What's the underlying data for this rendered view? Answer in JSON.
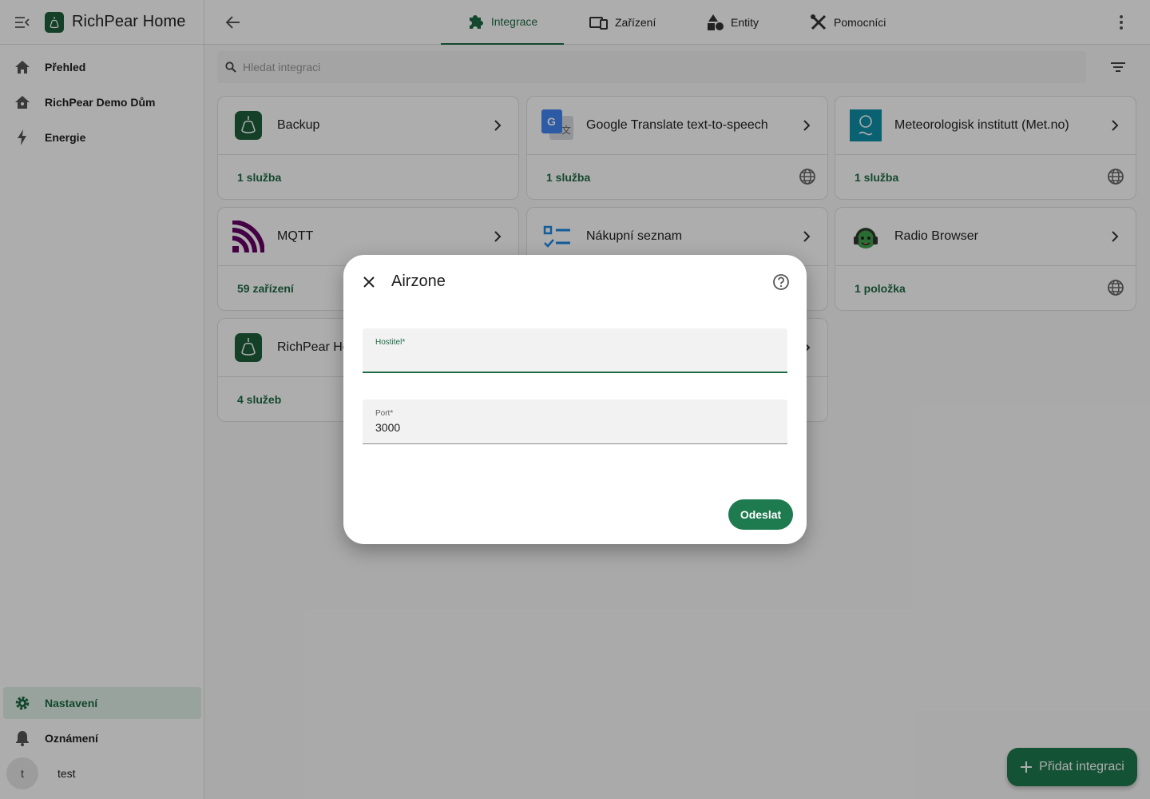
{
  "app": {
    "title": "RichPear Home"
  },
  "sidebar": {
    "items": [
      {
        "label": "Přehled",
        "icon": "home-icon"
      },
      {
        "label": "RichPear Demo Dům",
        "icon": "home-outline-icon"
      },
      {
        "label": "Energie",
        "icon": "lightning-icon"
      }
    ],
    "bottom": [
      {
        "label": "Nastavení",
        "icon": "gear-icon",
        "active": true
      },
      {
        "label": "Oznámení",
        "icon": "bell-icon"
      }
    ],
    "user": {
      "initial": "t",
      "name": "test"
    }
  },
  "tabs": [
    {
      "label": "Integrace",
      "icon": "puzzle-icon",
      "active": true
    },
    {
      "label": "Zařízení",
      "icon": "devices-icon"
    },
    {
      "label": "Entity",
      "icon": "shapes-icon"
    },
    {
      "label": "Pomocníci",
      "icon": "tools-icon"
    }
  ],
  "search": {
    "placeholder": "Hledat integraci"
  },
  "cards": [
    {
      "name": "Backup",
      "count": "1 služba",
      "logo": "richpear-logo",
      "cloud": false
    },
    {
      "name": "Google Translate text-to-speech",
      "count": "1 služba",
      "logo": "google-translate-logo",
      "cloud": true
    },
    {
      "name": "Meteorologisk institutt (Met.no)",
      "count": "1 služba",
      "logo": "met-no-logo",
      "cloud": true
    },
    {
      "name": "MQTT",
      "count": "59 zařízení",
      "logo": "mqtt-logo",
      "cloud": false
    },
    {
      "name": "Nákupní seznam",
      "count": "",
      "logo": "checklist-logo",
      "cloud": false
    },
    {
      "name": "Radio Browser",
      "count": "1 položka",
      "logo": "radio-browser-logo",
      "cloud": true
    },
    {
      "name": "RichPear Ho",
      "count": "4 služeb",
      "logo": "richpear-logo",
      "cloud": false
    }
  ],
  "fab": {
    "label": "Přidat integraci"
  },
  "dialog": {
    "title": "Airzone",
    "fields": [
      {
        "label": "Hostitel*",
        "value": ""
      },
      {
        "label": "Port*",
        "value": "3000"
      }
    ],
    "submit_label": "Odeslat"
  },
  "colors": {
    "accent": "#1e6b45",
    "brand": "#1e5f3c"
  }
}
